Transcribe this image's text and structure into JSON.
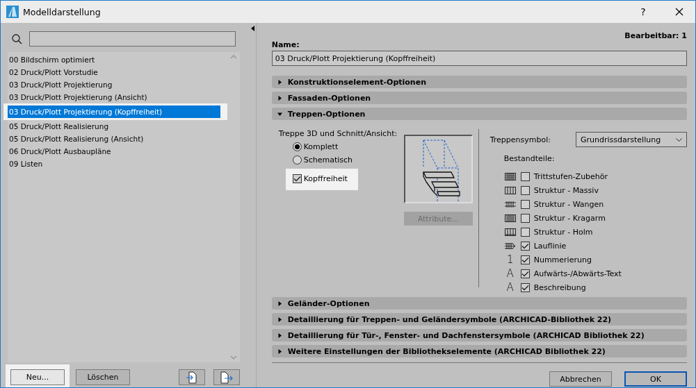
{
  "window": {
    "title": "Modelldarstellung",
    "help": "?"
  },
  "list": [
    {
      "label": "00 Bildschirm optimiert",
      "selected": false,
      "highlighted": false
    },
    {
      "label": "02 Druck/Plott Vorstudie",
      "selected": false,
      "highlighted": false
    },
    {
      "label": "03 Druck/Plott Projektierung",
      "selected": false,
      "highlighted": false
    },
    {
      "label": "03 Druck/Plott Projektierung (Ansicht)",
      "selected": false,
      "highlighted": false
    },
    {
      "label": "03 Druck/Plott Projektierung (Kopffreiheit)",
      "selected": true,
      "highlighted": true
    },
    {
      "label": "05 Druck/Plott Realisierung",
      "selected": false,
      "highlighted": false
    },
    {
      "label": "05 Druck/Plott Realisierung (Ansicht)",
      "selected": false,
      "highlighted": false
    },
    {
      "label": "06 Druck/Plott Ausbaupläne",
      "selected": false,
      "highlighted": false
    },
    {
      "label": "09 Listen",
      "selected": false,
      "highlighted": false
    }
  ],
  "left_buttons": [
    {
      "label": "Neu...",
      "highlighted": true
    },
    {
      "label": "Löschen",
      "highlighted": false
    }
  ],
  "editable": "Bearbeitbar: 1",
  "name": {
    "label": "Name:",
    "value": "03 Druck/Plott Projektierung (Kopffreiheit)"
  },
  "sections_top": [
    {
      "title": "Konstruktionselement-Optionen",
      "expanded": false
    },
    {
      "title": "Fassaden-Optionen",
      "expanded": false
    },
    {
      "title": "Treppen-Optionen",
      "expanded": true
    }
  ],
  "stair": {
    "heading": "Treppe 3D und Schnitt/Ansicht:",
    "modes": [
      {
        "label": "Komplett",
        "selected": true
      },
      {
        "label": "Schematisch",
        "selected": false
      }
    ],
    "headroom": {
      "label": "Kopffreiheit",
      "checked": true,
      "highlighted": true
    },
    "attributes_button": {
      "label": "Attribute...",
      "disabled": true
    },
    "symbol_label": "Treppensymbol:",
    "symbol_value": "Grundrissdarstellung",
    "components_label": "Bestandteile:",
    "components": [
      {
        "kind": "grid",
        "label": "Trittstufen-Zubehör",
        "checked": false
      },
      {
        "kind": "massiv",
        "label": "Struktur - Massiv",
        "checked": false
      },
      {
        "kind": "wangen",
        "label": "Struktur - Wangen",
        "checked": false
      },
      {
        "kind": "kragarm",
        "label": "Struktur - Kragarm",
        "checked": false
      },
      {
        "kind": "holm",
        "label": "Struktur - Holm",
        "checked": false
      },
      {
        "kind": "lauflinie",
        "label": "Lauflinie",
        "checked": true
      },
      {
        "kind": "glyph",
        "symbol": "1",
        "label": "Nummerierung",
        "checked": true
      },
      {
        "kind": "glyph",
        "symbol": "A",
        "label": "Aufwärts-/Abwärts-Text",
        "checked": true
      },
      {
        "kind": "glyph",
        "symbol": "A",
        "label": "Beschreibung",
        "checked": true
      }
    ]
  },
  "sections_bottom": [
    {
      "title": "Geländer-Optionen",
      "expanded": false
    },
    {
      "title": "Detaillierung für Treppen- und Geländersymbole (ARCHICAD-Bibliothek 22)",
      "expanded": false
    },
    {
      "title": "Detaillierung für Tür-, Fenster- und Dachfenstersymbole (ARCHICAD Bibliothek 22)",
      "expanded": false
    },
    {
      "title": "Weitere Einstellungen der Bibliothekselemente (ARCHICAD Bibliothek 22)",
      "expanded": false
    }
  ],
  "footer_buttons": [
    {
      "label": "Abbrechen",
      "default": false
    },
    {
      "label": "OK",
      "default": true
    }
  ]
}
